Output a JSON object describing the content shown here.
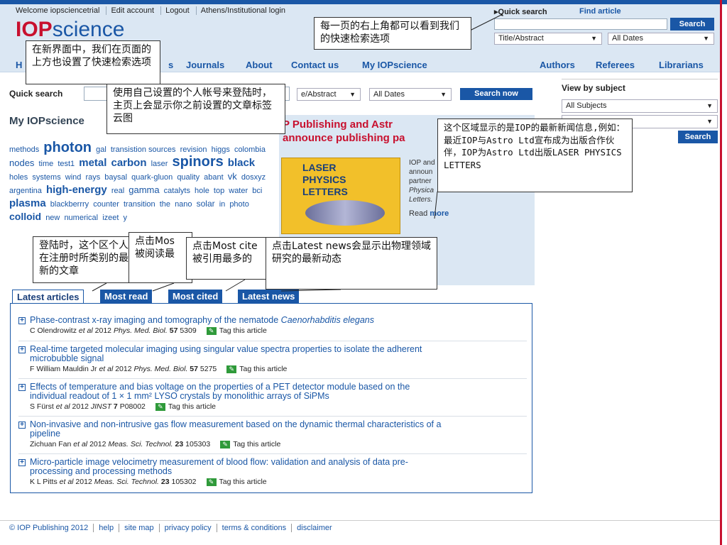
{
  "header": {
    "top_links": [
      "Welcome iopsciencetrial",
      "Edit account",
      "Logout",
      "Athens/Institutional login"
    ],
    "logo_iop": "IOP",
    "logo_science": "science",
    "quick_search_label": "▸Quick search",
    "find_article_label": "Find article",
    "search_button": "Search",
    "field_select": "Title/Abstract",
    "date_select": "All Dates"
  },
  "nav": {
    "items": [
      "Journals",
      "About",
      "Contact us",
      "My IOPscience",
      "Authors",
      "Referees",
      "Librarians"
    ],
    "first_item_partial": "H",
    "partial_after_callout": "s"
  },
  "quick_search": {
    "label": "Quick search",
    "field_select": "e/Abstract",
    "date_select": "All Dates",
    "button": "Search now"
  },
  "my_iopscience": {
    "title": "My IOPscience",
    "tags": [
      {
        "text": "methods",
        "size": 11
      },
      {
        "text": "photon",
        "size": 20
      },
      {
        "text": "gal",
        "size": 11
      },
      {
        "text": "transistion sources",
        "size": 11
      },
      {
        "text": "revision",
        "size": 11
      },
      {
        "text": "higgs",
        "size": 11
      },
      {
        "text": "colombia",
        "size": 11
      },
      {
        "text": "nodes",
        "size": 13
      },
      {
        "text": "time",
        "size": 11
      },
      {
        "text": "test1",
        "size": 11
      },
      {
        "text": "metal",
        "size": 15
      },
      {
        "text": "carbon",
        "size": 15
      },
      {
        "text": "laser",
        "size": 11
      },
      {
        "text": "spinors",
        "size": 20
      },
      {
        "text": "black",
        "size": 15
      },
      {
        "text": "holes",
        "size": 11
      },
      {
        "text": "systems",
        "size": 11
      },
      {
        "text": "wind",
        "size": 11
      },
      {
        "text": "rays",
        "size": 11
      },
      {
        "text": "baysal",
        "size": 11
      },
      {
        "text": "quark-gluon",
        "size": 11
      },
      {
        "text": "quality",
        "size": 11
      },
      {
        "text": "abant",
        "size": 11
      },
      {
        "text": "vk",
        "size": 13
      },
      {
        "text": "dosxyz",
        "size": 11
      },
      {
        "text": "argentina",
        "size": 11
      },
      {
        "text": "high-energy",
        "size": 15
      },
      {
        "text": "real",
        "size": 11
      },
      {
        "text": "gamma",
        "size": 13
      },
      {
        "text": "catalyts",
        "size": 11
      },
      {
        "text": "hole",
        "size": 11
      },
      {
        "text": "top",
        "size": 11
      },
      {
        "text": "water",
        "size": 11
      },
      {
        "text": "bci",
        "size": 11
      },
      {
        "text": "plasma",
        "size": 15
      },
      {
        "text": "blackberrry",
        "size": 11
      },
      {
        "text": "counter",
        "size": 11
      },
      {
        "text": "transition",
        "size": 11
      },
      {
        "text": "the",
        "size": 11
      },
      {
        "text": "nano",
        "size": 11
      },
      {
        "text": "solar",
        "size": 12
      },
      {
        "text": "in",
        "size": 11
      },
      {
        "text": "photo",
        "size": 11
      },
      {
        "text": "colloid",
        "size": 14
      },
      {
        "text": "new",
        "size": 11
      },
      {
        "text": "numerical",
        "size": 11
      },
      {
        "text": "izeet",
        "size": 11
      },
      {
        "text": "y",
        "size": 11
      }
    ]
  },
  "news": {
    "title": "P Publishing and Astr… announce publishing pa…",
    "title_line1": "P Publishing and Astr",
    "title_line2": "announce publishing pa",
    "book_title_lines": [
      "LASER",
      "PHYSICS",
      "LETTERS"
    ],
    "text_lines": [
      "IOP and",
      "announ",
      "partner",
      "Physica",
      "Letters."
    ],
    "read_label": "Read",
    "more_label": "more"
  },
  "sidebar": {
    "title": "View by subject",
    "subject_select": "All Subjects",
    "second_select": "",
    "search_button": "Search"
  },
  "tabs": [
    "Latest articles",
    "Most read",
    "Most cited",
    "Latest news"
  ],
  "articles": [
    {
      "title": "Phase-contrast x-ray imaging and tomography of the nematode ",
      "title_italic": "Caenorhabditis elegans",
      "title_line2": "",
      "authors": "C Olendrowitz",
      "etal": "et al",
      "year": "2012",
      "journal": "Phys. Med. Biol.",
      "volume": "57",
      "page": "5309",
      "tag": "Tag this article"
    },
    {
      "title": "Real-time targeted molecular imaging using singular value spectra properties to isolate the adherent",
      "title_italic": "",
      "title_line2": "microbubble signal",
      "authors": "F William Mauldin Jr",
      "etal": "et al",
      "year": "2012",
      "journal": "Phys. Med. Biol.",
      "volume": "57",
      "page": "5275",
      "tag": "Tag this article"
    },
    {
      "title": "Effects of temperature and bias voltage on the properties of a PET detector module based on the",
      "title_italic": "",
      "title_line2": "individual readout of 1 × 1 mm² LYSO crystals by monolithic arrays of SiPMs",
      "authors": "S Fürst",
      "etal": "et al",
      "year": "2012",
      "journal": "JINST",
      "volume": "7",
      "page": "P08002",
      "tag": "Tag this article"
    },
    {
      "title": "Non-invasive and non-intrusive gas flow measurement based on the dynamic thermal characteristics of a",
      "title_italic": "",
      "title_line2": "pipeline",
      "authors": "Zichuan Fan",
      "etal": "et al",
      "year": "2012",
      "journal": "Meas. Sci. Technol.",
      "volume": "23",
      "page": "105303",
      "tag": "Tag this article"
    },
    {
      "title": "Micro-particle image velocimetry measurement of blood flow: validation and analysis of data pre-",
      "title_italic": "",
      "title_line2": "processing and processing methods",
      "authors": "K L Pitts",
      "etal": "et al",
      "year": "2012",
      "journal": "Meas. Sci. Technol.",
      "volume": "23",
      "page": "105302",
      "tag": "Tag this article"
    }
  ],
  "footer": [
    "© IOP Publishing 2012",
    "help",
    "site map",
    "privacy policy",
    "terms & conditions",
    "disclaimer"
  ],
  "callouts": {
    "quick_search_note": "每一页的右上角都可以看到我们的快速检索选项",
    "new_ui_note": "在新界面中，我们在页面的上方也设置了快速检索选项",
    "tag_cloud_note": "使用自己设置的个人帐号来登陆时，主页上会显示你之前设置的文章标签云图",
    "news_note": "这个区域显示的是IOP的最新新闻信息,例如：最近IOP与Astro Ltd宣布成为出版合作伙伴，IOP为Astro Ltd出版LASER PHYSICS LETTERS",
    "latest_articles_note": "登陆时，这个区个人在注册时所类别的最新的文章",
    "most_read_note_l1": "点击Mos",
    "most_read_note_l2": "被阅读最",
    "most_cited_note_l1": "点击Most cite",
    "most_cited_note_l2": "被引用最多的",
    "latest_news_note": "点击Latest  news会显示出物理领域研究的最新动态"
  },
  "colors": {
    "brand_blue": "#1a57a6",
    "brand_red": "#c8102e",
    "header_bg": "#dbe7f3",
    "tag_green": "#2f9a3a"
  }
}
